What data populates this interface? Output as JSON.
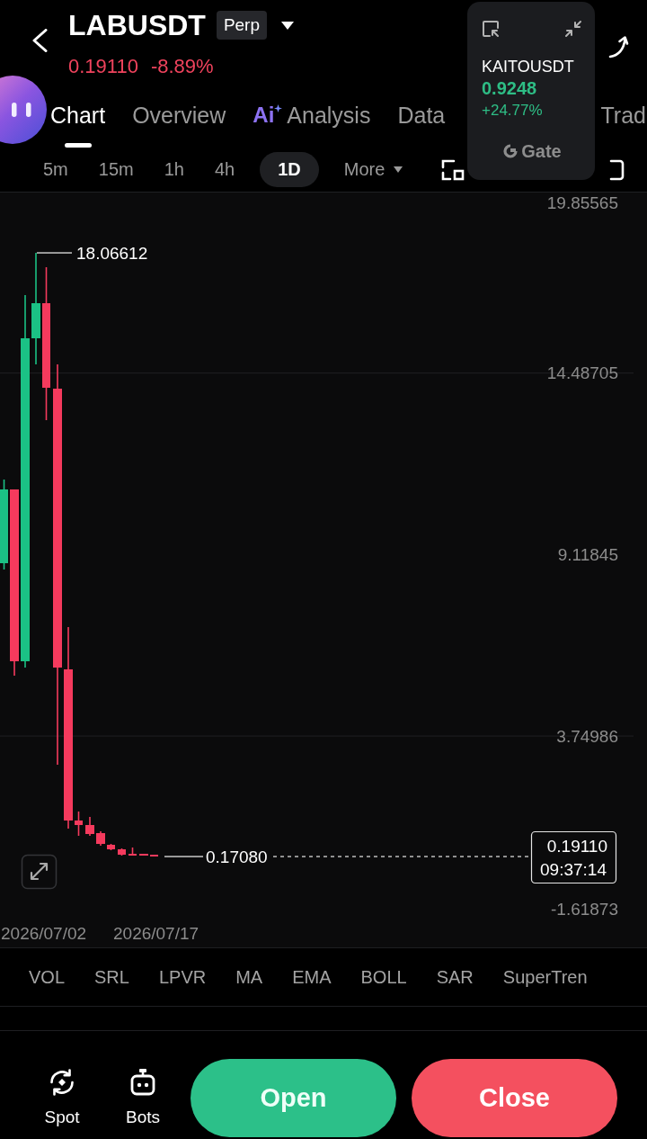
{
  "header": {
    "title": "LABUSDT",
    "badge": "Perp",
    "price": "0.19110",
    "change": "-8.89%",
    "rising": false
  },
  "tabs": [
    {
      "label": "Chart",
      "selected": true
    },
    {
      "label": "Overview",
      "selected": false
    },
    {
      "label": "Analysis",
      "badge": "Ai",
      "selected": false
    },
    {
      "label": "Data",
      "selected": false
    },
    {
      "label": "Trad",
      "selected": false
    }
  ],
  "intervals": [
    {
      "label": "5m",
      "kind": "interval",
      "selected": false
    },
    {
      "label": "15m",
      "kind": "interval",
      "selected": false
    },
    {
      "label": "1h",
      "kind": "interval",
      "selected": false
    },
    {
      "label": "4h",
      "kind": "interval",
      "selected": false
    },
    {
      "label": "1D",
      "kind": "interval",
      "selected": true
    },
    {
      "label": "More",
      "kind": "menu",
      "selected": false
    }
  ],
  "chart": {
    "y_axis_labels": [
      "19.85565",
      "14.48705",
      "9.11845",
      "3.74986",
      "-1.61873"
    ],
    "high_label": "18.06612",
    "low_label": "0.17080",
    "last_price": "0.19110",
    "countdown": "09:37:14",
    "dates": [
      "2026/07/02",
      "2026/07/17"
    ]
  },
  "indicators": [
    "VOL",
    "SRL",
    "LPVR",
    "MA",
    "EMA",
    "BOLL",
    "SAR",
    "SuperTren"
  ],
  "bottom_bar": {
    "shortcuts": [
      {
        "label": "Spot",
        "kind": "spot"
      },
      {
        "label": "Bots",
        "kind": "bots"
      }
    ],
    "buttons": [
      {
        "label": "Open",
        "kind": "open"
      },
      {
        "label": "Close",
        "kind": "close"
      }
    ]
  },
  "mini_ticker": {
    "symbol": "KAITOUSDT",
    "price": "0.9248",
    "change": "+24.77%",
    "rising": true,
    "logo": "Gate"
  }
}
